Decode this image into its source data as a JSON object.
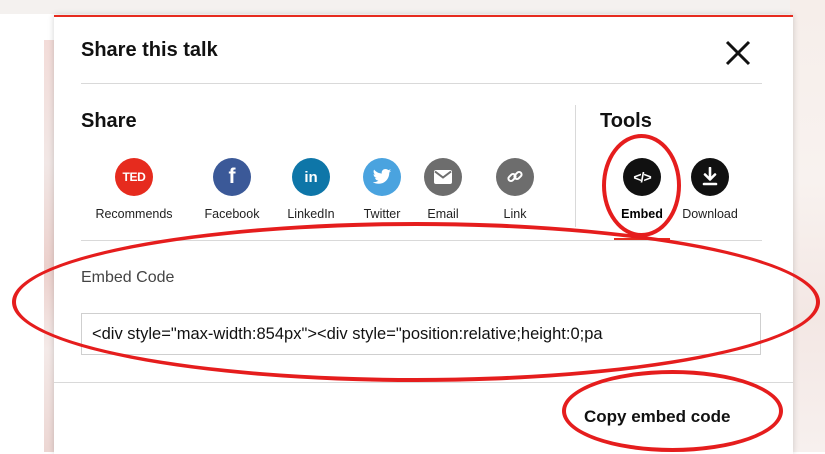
{
  "modal": {
    "title": "Share this talk",
    "close_icon": "close-icon",
    "accent_color": "#e62b1e"
  },
  "share": {
    "heading": "Share",
    "items": [
      {
        "label": "Recommends",
        "icon": "ted-icon",
        "icon_text": "TED",
        "color": "#e62b1e"
      },
      {
        "label": "Facebook",
        "icon": "facebook-icon",
        "color": "#3b5998"
      },
      {
        "label": "LinkedIn",
        "icon": "linkedin-icon",
        "color": "#0e76a8"
      },
      {
        "label": "Twitter",
        "icon": "twitter-icon",
        "color": "#4aa3df"
      },
      {
        "label": "Email",
        "icon": "email-icon",
        "color": "#6d6d6d"
      },
      {
        "label": "Link",
        "icon": "link-icon",
        "color": "#6d6d6d"
      }
    ]
  },
  "tools": {
    "heading": "Tools",
    "items": [
      {
        "label": "Embed",
        "icon": "embed-code-icon",
        "color": "#111111",
        "active": true
      },
      {
        "label": "Download",
        "icon": "download-icon",
        "color": "#111111",
        "active": false
      }
    ]
  },
  "embed": {
    "label": "Embed Code",
    "code_value": "<div style=\"max-width:854px\"><div style=\"position:relative;height:0;pa"
  },
  "copy_button": {
    "label": "Copy embed code"
  },
  "annotation_color": "#e51d1d"
}
